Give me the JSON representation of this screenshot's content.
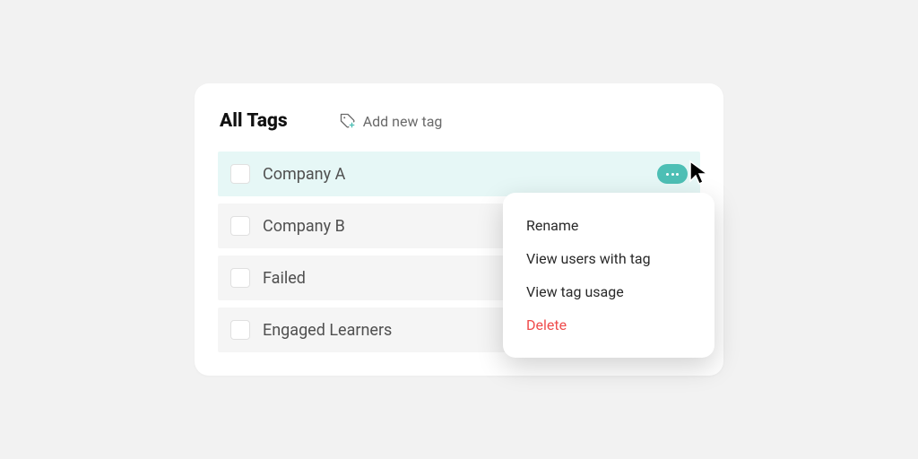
{
  "header": {
    "title": "All Tags",
    "add_label": "Add new tag"
  },
  "tags": [
    {
      "label": "Company A"
    },
    {
      "label": "Company B"
    },
    {
      "label": "Failed"
    },
    {
      "label": "Engaged Learners"
    }
  ],
  "menu": {
    "rename": "Rename",
    "view_users": "View users with tag",
    "view_usage": "View tag usage",
    "delete": "Delete"
  }
}
